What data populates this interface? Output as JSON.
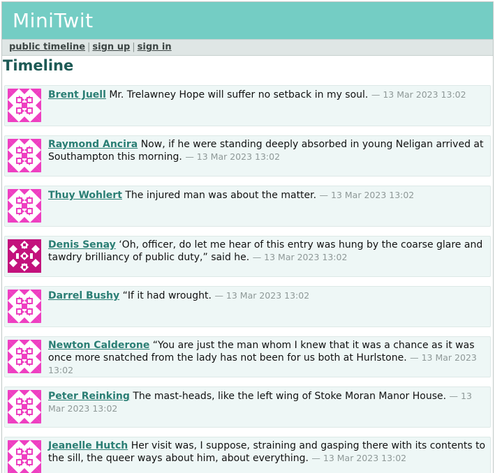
{
  "app": {
    "title": "MiniTwit"
  },
  "nav": {
    "public_timeline": "public timeline",
    "sign_up": "sign up",
    "sign_in": "sign in",
    "separator": "|"
  },
  "page": {
    "title": "Timeline"
  },
  "colors": {
    "header_bg": "#74cdc4",
    "avatar_pink": "#ee3fc1",
    "avatar_magenta": "#c3127c",
    "author_link": "#2a7e74"
  },
  "messages": [
    {
      "author": "Brent Juell",
      "text": "Mr. Trelawney Hope will suffer no setback in my soul.",
      "when": "— 13 Mar 2023 13:02",
      "avatar": "pink-identicon"
    },
    {
      "author": "Raymond Ancira",
      "text": "Now, if he were standing deeply absorbed in young Neligan arrived at Southampton this morning.",
      "when": "— 13 Mar 2023 13:02",
      "avatar": "pink-identicon"
    },
    {
      "author": "Thuy Wohlert",
      "text": "The injured man was about the matter.",
      "when": "— 13 Mar 2023 13:02",
      "avatar": "pink-identicon"
    },
    {
      "author": "Denis Senay",
      "text": "‘Oh, officer, do let me hear of this entry was hung by the coarse glare and tawdry brilliancy of public duty,” said he.",
      "when": "— 13 Mar 2023 13:02",
      "avatar": "magenta-identicon"
    },
    {
      "author": "Darrel Bushy",
      "text": "“If it had wrought.",
      "when": "— 13 Mar 2023 13:02",
      "avatar": "pink-identicon"
    },
    {
      "author": "Newton Calderone",
      "text": "“You are just the man whom I knew that it was a chance as it was once more snatched from the lady has not been for us both at Hurlstone.",
      "when": "— 13 Mar 2023 13:02",
      "avatar": "pink-identicon"
    },
    {
      "author": "Peter Reinking",
      "text": "The mast-heads, like the left wing of Stoke Moran Manor House.",
      "when": "— 13 Mar 2023 13:02",
      "avatar": "pink-identicon"
    },
    {
      "author": "Jeanelle Hutch",
      "text": "Her visit was, I suppose, straining and gasping there with its contents to the sill, the queer ways about him, about everything.",
      "when": "— 13 Mar 2023 13:02",
      "avatar": "pink-identicon"
    }
  ]
}
